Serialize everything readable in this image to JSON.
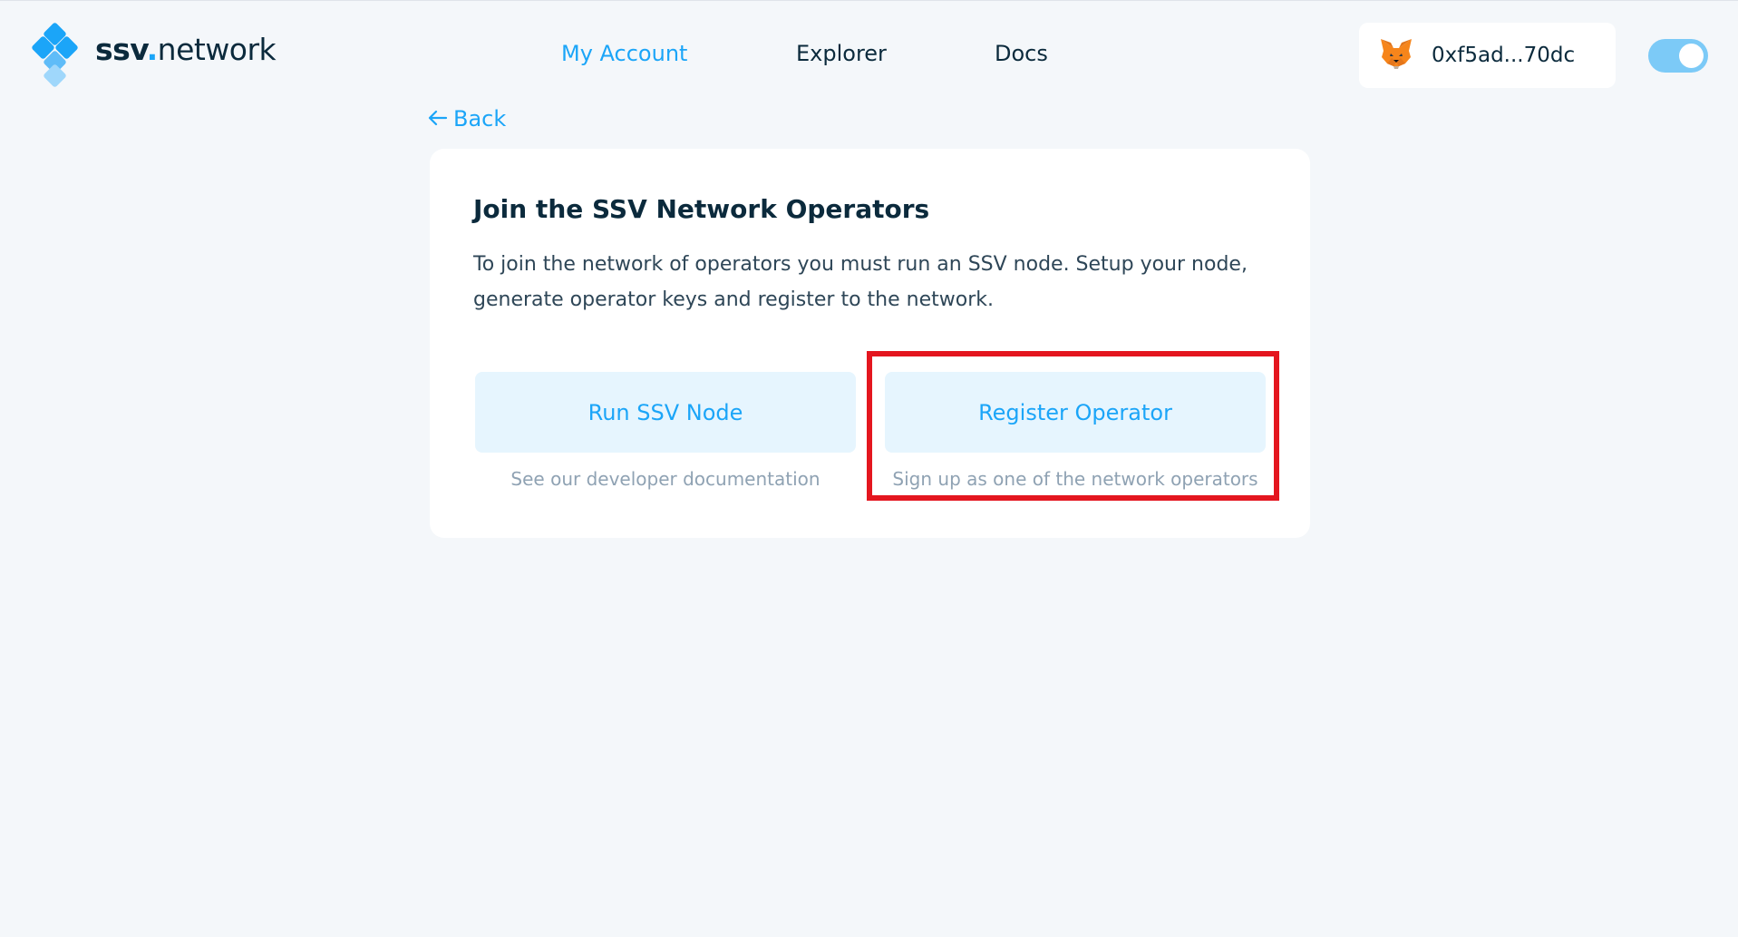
{
  "header": {
    "logo": {
      "brand_bold": "ssv",
      "brand_dot": ".",
      "brand_rest": "network",
      "accent_color": "#1ba5f8"
    },
    "nav": [
      {
        "label": "My Account",
        "active": true
      },
      {
        "label": "Explorer",
        "active": false
      },
      {
        "label": "Docs",
        "active": false
      }
    ],
    "wallet": {
      "icon": "metamask-fox-icon",
      "address": "0xf5ad...70dc"
    },
    "theme_toggle": {
      "icon": "theme-toggle",
      "on": true
    }
  },
  "back": {
    "icon": "arrow-left-icon",
    "label": "Back"
  },
  "card": {
    "title": "Join the SSV Network Operators",
    "description": "To join the network of operators you must run an SSV node. Setup your node, generate operator keys and register to the network.",
    "options": [
      {
        "label": "Run SSV Node",
        "subtitle": "See our developer documentation"
      },
      {
        "label": "Register Operator",
        "subtitle": "Sign up as one of the network operators",
        "highlighted": true
      }
    ]
  },
  "colors": {
    "background": "#f4f7fa",
    "primary": "#1ba5f8",
    "button_bg": "#e6f5fe",
    "highlight": "#e4161f",
    "text": "#0b2a3c",
    "muted": "#8fa2b3"
  }
}
